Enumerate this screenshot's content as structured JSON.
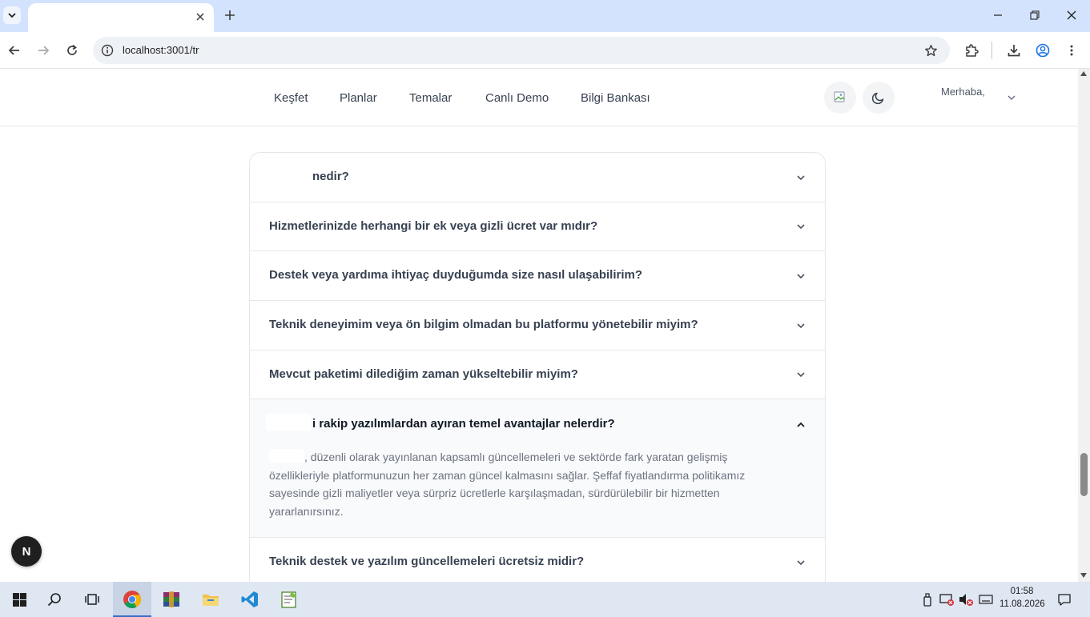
{
  "browser": {
    "url": "localhost:3001/tr"
  },
  "nav": {
    "links": [
      "Keşfet",
      "Planlar",
      "Temalar",
      "Canlı Demo",
      "Bilgi Bankası"
    ],
    "greeting": "Merhaba,"
  },
  "faq": {
    "items": [
      {
        "question": "nedir?"
      },
      {
        "question": "Hizmetlerinizde herhangi bir ek veya gizli ücret var mıdır?"
      },
      {
        "question": "Destek veya yardıma ihtiyaç duyduğumda size nasıl ulaşabilirim?"
      },
      {
        "question": "Teknik deneyimim veya ön bilgim olmadan bu platformu yönetebilir miyim?"
      },
      {
        "question": "Mevcut paketimi dilediğim zaman yükseltebilir miyim?"
      },
      {
        "question": "i rakip yazılımlardan ayıran temel avantajlar nelerdir?",
        "answer": ", düzenli olarak yayınlanan kapsamlı güncellemeleri ve sektörde fark yaratan gelişmiş özellikleriyle platformunuzun her zaman güncel kalmasını sağlar. Şeffaf fiyatlandırma politikamız sayesinde gizli maliyetler veya sürpriz ücretlerle karşılaşmadan, sürdürülebilir bir hizmetten yararlanırsınız."
      },
      {
        "question": "Teknik destek ve yazılım güncellemeleri ücretsiz midir?"
      }
    ]
  },
  "badge": {
    "letter": "N"
  },
  "taskbar": {
    "time": "01:58",
    "date": "11.08.2026"
  },
  "colors": {
    "tabstrip": "#d3e3fd",
    "taskbar": "#dfe7f3",
    "faq_border": "#e5e7eb"
  }
}
